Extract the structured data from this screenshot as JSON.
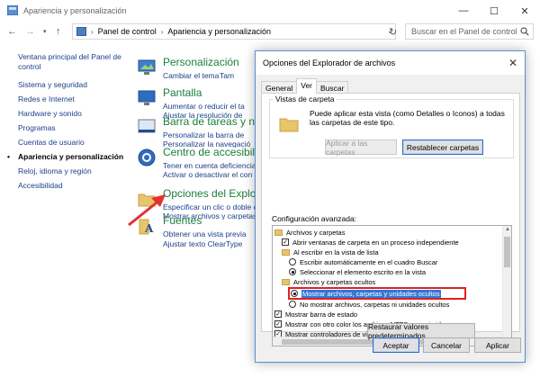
{
  "window": {
    "title": "Apariencia y personalización"
  },
  "navbar": {
    "crumb1": "Panel de control",
    "crumb2": "Apariencia y personalización",
    "search_placeholder": "Buscar en el Panel de control"
  },
  "sidebar": {
    "items": [
      {
        "label": "Ventana principal del Panel de control"
      },
      {
        "label": "Sistema y seguridad"
      },
      {
        "label": "Redes e Internet"
      },
      {
        "label": "Hardware y sonido"
      },
      {
        "label": "Programas"
      },
      {
        "label": "Cuentas de usuario"
      },
      {
        "label": "Apariencia y personalización"
      },
      {
        "label": "Reloj, idioma y región"
      },
      {
        "label": "Accesibilidad"
      }
    ]
  },
  "categories": [
    {
      "title": "Personalización",
      "links": [
        "Cambiar el tema",
        "Tam"
      ]
    },
    {
      "title": "Pantalla",
      "links": [
        "Aumentar o reducir el ta",
        "Ajustar la resolución de"
      ]
    },
    {
      "title": "Barra de tareas y nave",
      "links": [
        "Personalizar la barra de",
        "Personalizar la navegació"
      ]
    },
    {
      "title": "Centro de accesibilid",
      "links": [
        "Tener en cuenta deficiencias",
        "Activar o desactivar el con"
      ]
    },
    {
      "title": "Opciones del Explorad",
      "links": [
        "Especificar un clic o doble cl",
        "Mostrar archivos y carpetas"
      ]
    },
    {
      "title": "Fuentes",
      "links": [
        "Obtener una vista previa",
        "Ajustar texto ClearType"
      ]
    }
  ],
  "dialog": {
    "title": "Opciones del Explorador de archivos",
    "tabs": [
      "General",
      "Ver",
      "Buscar"
    ],
    "vistas_label": "Vistas de carpeta",
    "vistas_desc": "Puede aplicar esta vista (como Detalles o Iconos) a todas las carpetas de este tipo.",
    "btn_aplicar_carpetas": "Aplicar a las carpetas",
    "btn_restablecer": "Restablecer carpetas",
    "advanced_label": "Configuración avanzada:",
    "advanced_items": [
      {
        "kind": "folder",
        "label": "Archivos y carpetas"
      },
      {
        "kind": "check",
        "checked": true,
        "label": "Abrir ventanas de carpeta en un proceso independiente"
      },
      {
        "kind": "folder",
        "label": "Al escribir en la vista de lista"
      },
      {
        "kind": "radio",
        "checked": false,
        "label": "Escribir automáticamente en el cuadro Buscar"
      },
      {
        "kind": "radio",
        "checked": true,
        "label": "Seleccionar el elemento escrito en la vista"
      },
      {
        "kind": "folder",
        "label": "Archivos y carpetas ocultos"
      },
      {
        "kind": "radio",
        "checked": true,
        "label": "Mostrar archivos, carpetas y unidades ocultos"
      },
      {
        "kind": "radio",
        "checked": false,
        "label": "No mostrar archivos, carpetas ni unidades ocultos"
      },
      {
        "kind": "check",
        "checked": true,
        "label": "Mostrar barra de estado"
      },
      {
        "kind": "check",
        "checked": true,
        "label": "Mostrar con otro color los archivos NTFS comprimidos o c"
      },
      {
        "kind": "check",
        "checked": true,
        "label": "Mostrar controladores de vista previa en el panel de vista"
      }
    ],
    "btn_restaurar": "Restaurar valores predeterminados",
    "btn_aceptar": "Aceptar",
    "btn_cancelar": "Cancelar",
    "btn_aplicar": "Aplicar"
  }
}
